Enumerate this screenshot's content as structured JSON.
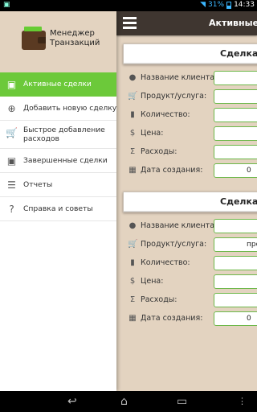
{
  "status_bar": {
    "battery_percent": "31%",
    "time": "14:33"
  },
  "top_bar": {
    "title": "Активные сд"
  },
  "drawer": {
    "app_title_line1": "Менеджер",
    "app_title_line2": "Транзакций",
    "items": [
      {
        "label": "Активные сделки",
        "icon": "briefcase-icon",
        "active": true
      },
      {
        "label": "Добавить новую сделку",
        "icon": "plus-circle-icon"
      },
      {
        "label": "Быстрое добавление расходов",
        "icon": "cart-add-icon"
      },
      {
        "label": "Завершенные сделки",
        "icon": "briefcase-icon"
      },
      {
        "label": "Отчеты",
        "icon": "report-icon"
      },
      {
        "label": "Справка и советы",
        "icon": "help-icon"
      }
    ]
  },
  "deals": [
    {
      "title": "Сделка N",
      "fields": [
        {
          "label": "Название клиента:",
          "icon": "person-icon",
          "value": ""
        },
        {
          "label": "Продукт/услуга:",
          "icon": "cart-icon",
          "value": ""
        },
        {
          "label": "Количество:",
          "icon": "bar-chart-icon",
          "value": ""
        },
        {
          "label": "Цена:",
          "icon": "dollar-icon",
          "value": ""
        },
        {
          "label": "Расходы:",
          "icon": "sigma-icon",
          "value": ""
        },
        {
          "label": "Дата создания:",
          "icon": "calendar-icon",
          "value": "0"
        }
      ]
    },
    {
      "title": "Сделка N",
      "fields": [
        {
          "label": "Название клиента:",
          "icon": "person-icon",
          "value": ""
        },
        {
          "label": "Продукт/услуга:",
          "icon": "cart-icon",
          "value": "про"
        },
        {
          "label": "Количество:",
          "icon": "bar-chart-icon",
          "value": ""
        },
        {
          "label": "Цена:",
          "icon": "dollar-icon",
          "value": ""
        },
        {
          "label": "Расходы:",
          "icon": "sigma-icon",
          "value": ""
        },
        {
          "label": "Дата создания:",
          "icon": "calendar-icon",
          "value": "0"
        }
      ]
    }
  ]
}
